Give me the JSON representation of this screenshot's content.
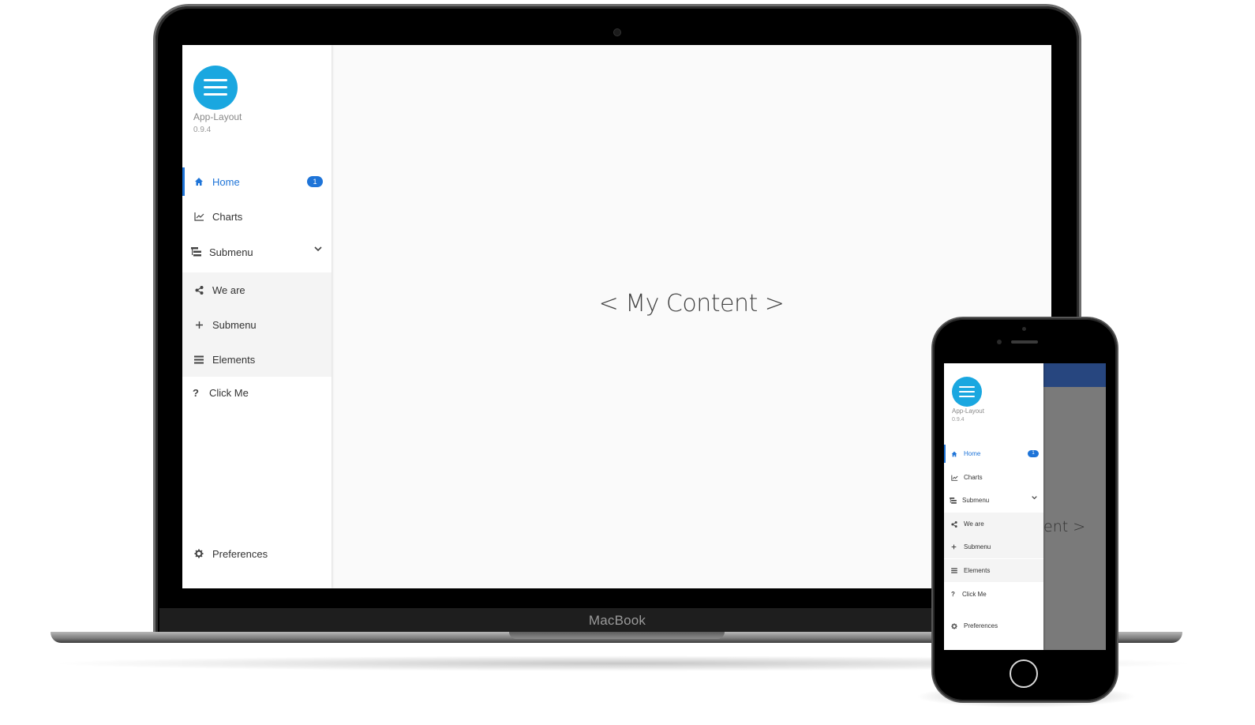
{
  "device": {
    "laptop_label": "MacBook"
  },
  "app": {
    "name": "App-Layout",
    "version": "0.9.4"
  },
  "nav": {
    "home": {
      "label": "Home",
      "icon": "home-icon",
      "badge": "1"
    },
    "charts": {
      "label": "Charts",
      "icon": "line-chart-icon"
    },
    "submenu": {
      "label": "Submenu",
      "icon": "tree-icon",
      "expanded": true
    },
    "we_are": {
      "label": "We are",
      "icon": "share-icon"
    },
    "submenu_nested": {
      "label": "Submenu",
      "icon": "plus-icon"
    },
    "elements": {
      "label": "Elements",
      "icon": "bars-icon"
    },
    "click_me": {
      "label": "Click Me",
      "icon": "question-icon"
    },
    "preferences": {
      "label": "Preferences",
      "icon": "gear-icon"
    }
  },
  "content": {
    "placeholder": "< My Content >",
    "phone_placeholder_visible": "ent >"
  },
  "colors": {
    "accent": "#1e74d8",
    "logo": "#1aa7e0",
    "phone_appbar": "#27467f"
  }
}
